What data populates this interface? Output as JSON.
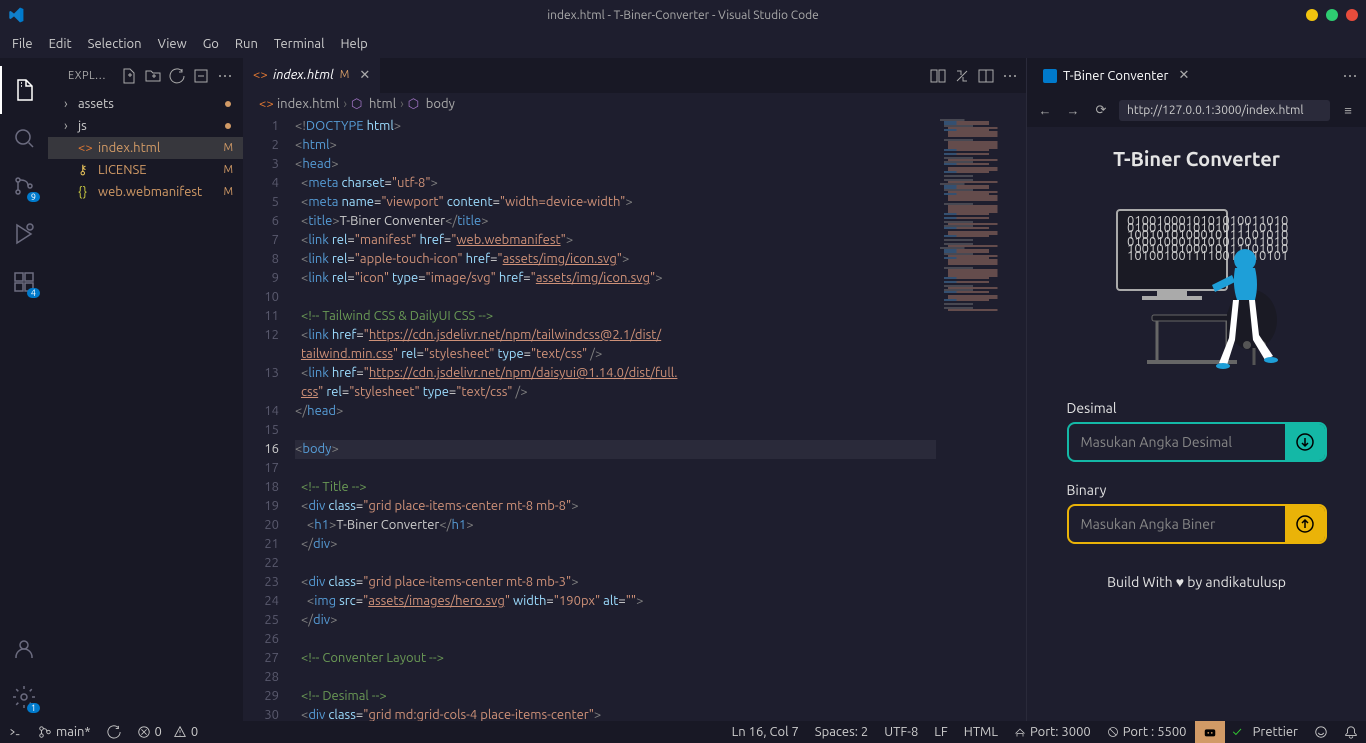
{
  "titlebar": {
    "title": "index.html - T-Biner-Converter - Visual Studio Code"
  },
  "menubar": [
    "File",
    "Edit",
    "Selection",
    "View",
    "Go",
    "Run",
    "Terminal",
    "Help"
  ],
  "sidebar": {
    "title": "EXPLORER",
    "files": [
      {
        "name": "assets",
        "folder": true,
        "status": "dot"
      },
      {
        "name": "js",
        "folder": true,
        "status": "dot"
      },
      {
        "name": "index.html",
        "folder": false,
        "status": "M",
        "selected": true,
        "icon": "html"
      },
      {
        "name": "LICENSE",
        "folder": false,
        "status": "M",
        "icon": "key"
      },
      {
        "name": "web.webmanifest",
        "folder": false,
        "status": "M",
        "icon": "json"
      }
    ]
  },
  "tab": {
    "name": "index.html",
    "status": "M"
  },
  "breadcrumb": [
    {
      "icon": "html",
      "label": "index.html"
    },
    {
      "icon": "tag",
      "label": "html"
    },
    {
      "icon": "tag",
      "label": "body"
    }
  ],
  "activity_badges": {
    "scm": "9",
    "ext": "4",
    "settings": "1"
  },
  "preview": {
    "tab_name": "T-Biner Conventer",
    "url": "http://127.0.0.1:3000/index.html",
    "title": "T-Biner Converter",
    "desimal_label": "Desimal",
    "desimal_placeholder": "Masukan Angka Desimal",
    "binary_label": "Binary",
    "binary_placeholder": "Masukan Angka Biner",
    "footer": "Build With ♥ by andikatulusp"
  },
  "statusbar": {
    "branch": "main*",
    "errors": "0",
    "warnings": "0",
    "cursor": "Ln 16, Col 7",
    "spaces": "Spaces: 2",
    "encoding": "UTF-8",
    "eol": "LF",
    "lang": "HTML",
    "port1": "Port: 3000",
    "port2": "Port : 5500",
    "prettier": "Prettier"
  },
  "code_lines": [
    1,
    2,
    3,
    4,
    5,
    6,
    7,
    8,
    9,
    10,
    11,
    12,
    13,
    14,
    15,
    16,
    17,
    18,
    19,
    20,
    21,
    22,
    23,
    24,
    25,
    26,
    27,
    28,
    29,
    30
  ],
  "active_line": 16
}
